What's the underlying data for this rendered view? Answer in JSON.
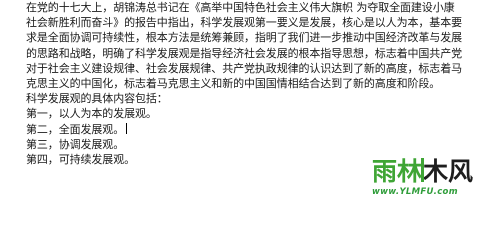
{
  "document": {
    "paragraph_lines": [
      "在党的十七大上，胡锦涛总书记在《高举中国特色社会主义伟大旗帜 为夺取全面建设小康",
      "社会新胜利而奋斗》的报告中指出，科学发展观第一要义是发展，核心是以人为本，基本要",
      "求是全面协调可持续性，根本方法是统筹兼顾，指明了我们进一步推动中国经济改革与发展",
      "的思路和战略，明确了科学发展观是指导经济社会发展的根本指导思想，标志着中国共产党",
      "对于社会主义建设规律、社会发展规律、共产党执政规律的认识达到了新的高度，标志着马",
      "克思主义的中国化，标志着马克思主义和新的中国国情相结合达到了新的高度和阶段。"
    ],
    "intro": "科学发展观的具体内容包括：",
    "items": [
      "第一，以人为本的发展观。",
      "第二，全面发展观。",
      "第三，协调发展观。",
      "第四，可持续发展观。"
    ]
  },
  "watermark": {
    "title": "雨林木风",
    "url": "www.YLMFU.com",
    "colors": {
      "green": "#3fa535",
      "dark": "#1e1e1e"
    }
  }
}
